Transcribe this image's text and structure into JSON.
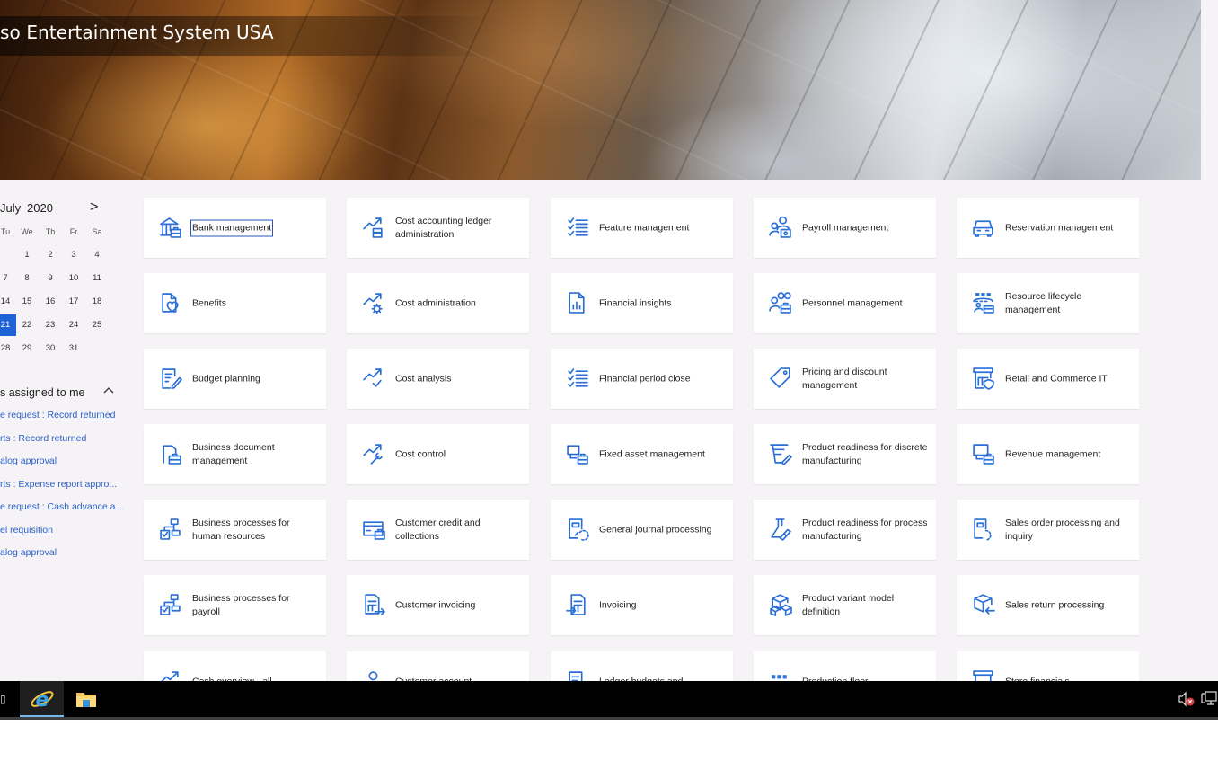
{
  "header": {
    "company_title": "so Entertainment System USA"
  },
  "calendar": {
    "month": "July",
    "year": "2020",
    "next_label": ">",
    "weekdays": [
      "Tu",
      "We",
      "Th",
      "Fr",
      "Sa"
    ],
    "weeks": [
      [
        "",
        "1",
        "2",
        "3",
        "4"
      ],
      [
        "7",
        "8",
        "9",
        "10",
        "11"
      ],
      [
        "14",
        "15",
        "16",
        "17",
        "18"
      ],
      [
        "21",
        "22",
        "23",
        "24",
        "25"
      ],
      [
        "28",
        "29",
        "30",
        "31",
        ""
      ]
    ],
    "selected_day": "21"
  },
  "work_items": {
    "title": "s assigned to me",
    "toggle_icon": "chevron-up-icon",
    "items": [
      "e request : Record returned",
      "rts : Record returned",
      "alog approval",
      "rts : Expense report appro...",
      "e request : Cash advance a...",
      "el requisition",
      "alog approval"
    ]
  },
  "tiles": {
    "columns": [
      [
        {
          "label": "Bank management",
          "icon": "bank-icon",
          "focused": true
        },
        {
          "label": "Benefits",
          "icon": "benefits-icon"
        },
        {
          "label": "Budget planning",
          "icon": "budget-planning-icon"
        },
        {
          "label": "Business document management",
          "icon": "business-document-icon"
        },
        {
          "label": "Business processes for human resources",
          "icon": "business-process-icon"
        },
        {
          "label": "Business processes for payroll",
          "icon": "business-process-icon"
        },
        {
          "label": "Cash overview - all",
          "icon": "trend-icon"
        }
      ],
      [
        {
          "label": "Cost accounting ledger administration",
          "icon": "trend-ledger-icon"
        },
        {
          "label": "Cost administration",
          "icon": "trend-gear-icon"
        },
        {
          "label": "Cost analysis",
          "icon": "trend-check-icon"
        },
        {
          "label": "Cost control",
          "icon": "trend-wrench-icon"
        },
        {
          "label": "Customer credit and collections",
          "icon": "credit-card-icon"
        },
        {
          "label": "Customer invoicing",
          "icon": "customer-invoice-icon"
        },
        {
          "label": "Customer account",
          "icon": "person-icon"
        }
      ],
      [
        {
          "label": "Feature management",
          "icon": "checklist-icon"
        },
        {
          "label": "Financial insights",
          "icon": "report-chart-icon"
        },
        {
          "label": "Financial period close",
          "icon": "checklist-icon"
        },
        {
          "label": "Fixed asset management",
          "icon": "fixed-asset-icon"
        },
        {
          "label": "General journal processing",
          "icon": "journal-icon"
        },
        {
          "label": "Invoicing",
          "icon": "invoice-icon"
        },
        {
          "label": "Ledger budgets and",
          "icon": "ledger-budget-icon"
        }
      ],
      [
        {
          "label": "Payroll management",
          "icon": "payroll-icon"
        },
        {
          "label": "Personnel management",
          "icon": "personnel-icon"
        },
        {
          "label": "Pricing and discount management",
          "icon": "price-tag-icon"
        },
        {
          "label": "Product readiness for discrete manufacturing",
          "icon": "discrete-manufacturing-icon"
        },
        {
          "label": "Product readiness for process manufacturing",
          "icon": "flask-icon"
        },
        {
          "label": "Product variant model definition",
          "icon": "product-variant-icon"
        },
        {
          "label": "Production floor",
          "icon": "production-floor-icon"
        }
      ],
      [
        {
          "label": "Reservation management",
          "icon": "car-icon"
        },
        {
          "label": "Resource lifecycle management",
          "icon": "resource-lifecycle-icon"
        },
        {
          "label": "Retail and Commerce IT",
          "icon": "store-shield-icon"
        },
        {
          "label": "Revenue management",
          "icon": "revenue-icon"
        },
        {
          "label": "Sales order processing and inquiry",
          "icon": "sales-order-icon"
        },
        {
          "label": "Sales return processing",
          "icon": "sales-return-icon"
        },
        {
          "label": "Store financials",
          "icon": "store-icon"
        }
      ]
    ]
  },
  "taskbar": {
    "apps": [
      {
        "name": "internet-explorer",
        "icon": "internet-explorer-icon",
        "active": true
      },
      {
        "name": "file-explorer",
        "icon": "folder-icon",
        "active": false
      }
    ],
    "tray": [
      {
        "icon": "volume-muted-icon"
      },
      {
        "icon": "network-icon"
      }
    ]
  },
  "colors": {
    "accent": "#1e63d6",
    "icon_blue": "#2b6fd6",
    "link": "#2a62c9",
    "page_bg": "#f6f3f6",
    "taskbar": "#000000"
  }
}
